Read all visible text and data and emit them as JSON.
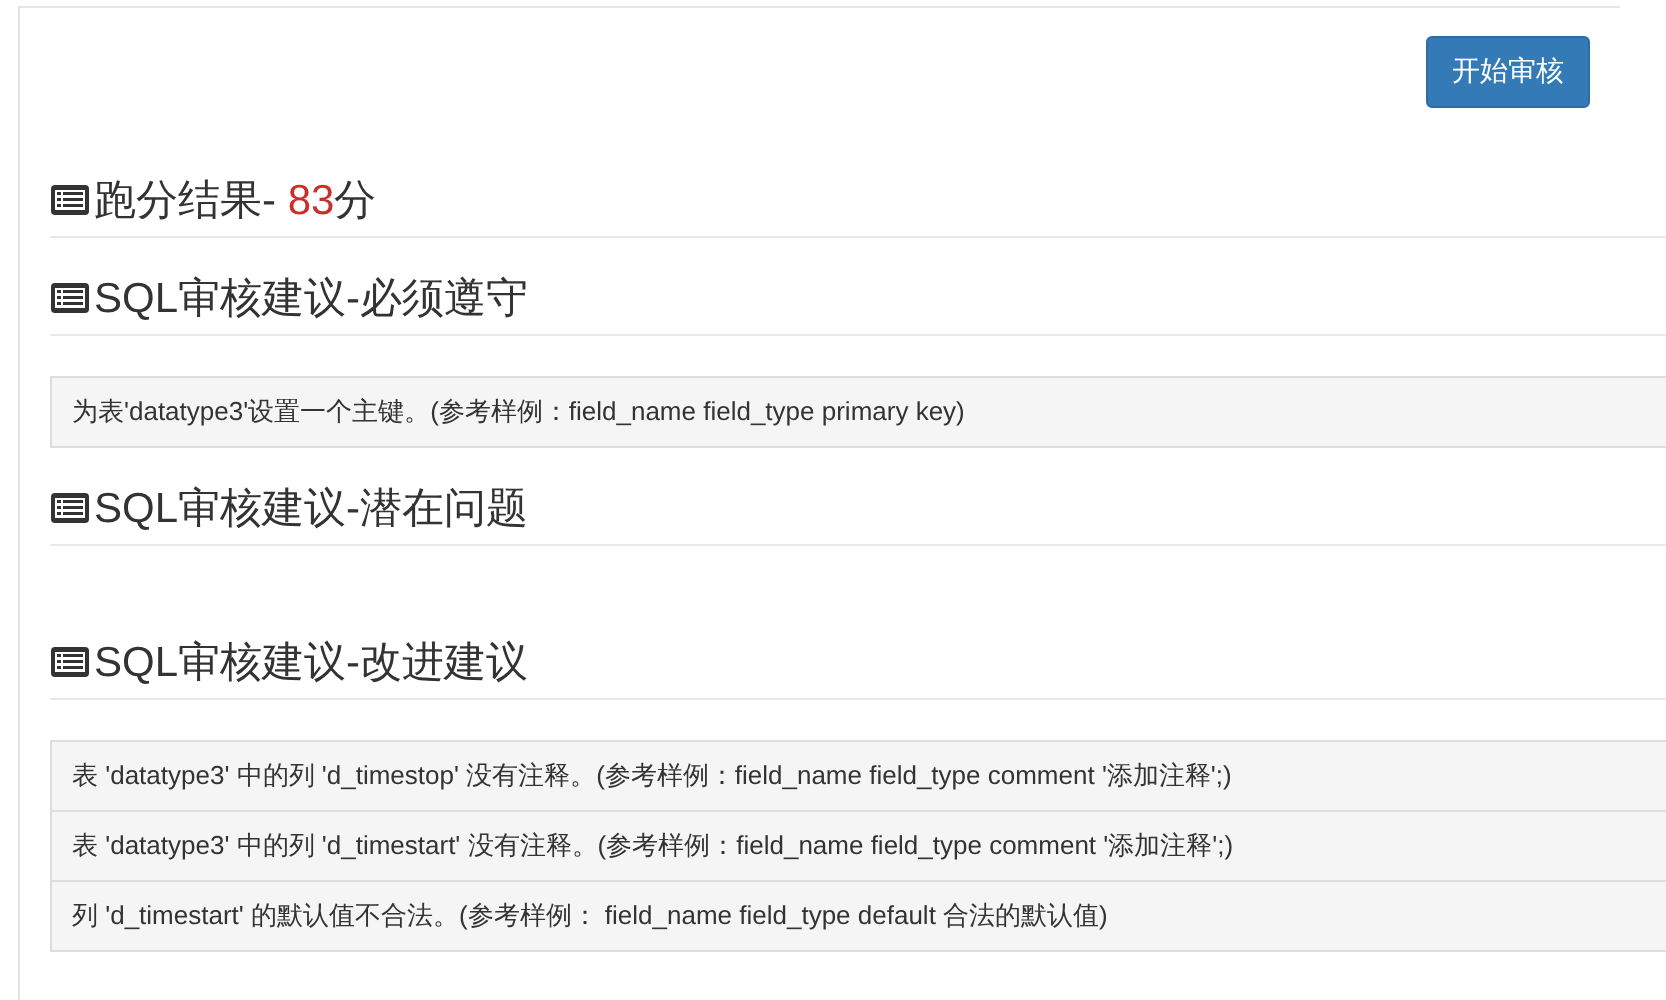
{
  "start_button": {
    "label": "开始审核"
  },
  "score": {
    "title": "跑分结果- ",
    "value": "83",
    "unit": "分"
  },
  "sections": [
    {
      "title": "SQL审核建议-必须遵守",
      "items": [
        "为表'datatype3'设置一个主键。(参考样例：field_name field_type primary key)"
      ]
    },
    {
      "title": "SQL审核建议-潜在问题"
    },
    {
      "title": "SQL审核建议-改进建议",
      "items": [
        "表 'datatype3' 中的列 'd_timestop' 没有注释。(参考样例：field_name field_type comment '添加注释';)",
        "表 'datatype3' 中的列 'd_timestart' 没有注释。(参考样例：field_name field_type comment '添加注释';)",
        "列 'd_timestart' 的默认值不合法。(参考样例： field_name field_type default 合法的默认值)"
      ]
    }
  ]
}
